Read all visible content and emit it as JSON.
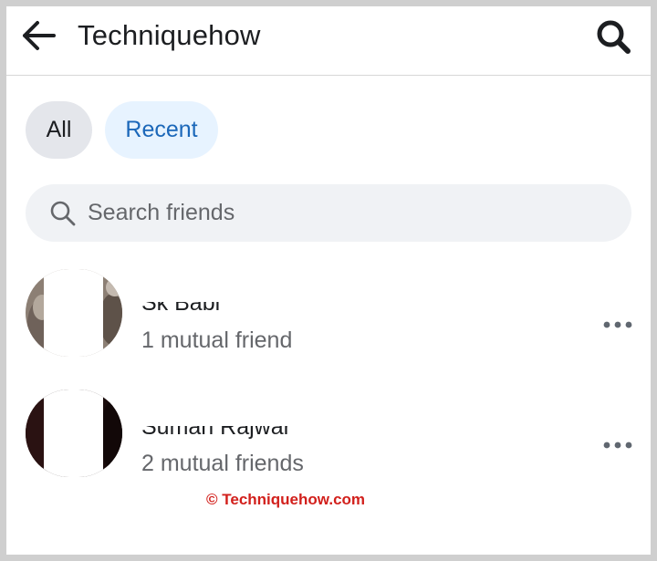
{
  "header": {
    "back_icon": "arrow-left-icon",
    "title": "Techniquehow",
    "search_icon": "search-icon"
  },
  "filters": [
    {
      "label": "All",
      "selected": false
    },
    {
      "label": "Recent",
      "selected": true
    }
  ],
  "search": {
    "icon": "search-icon",
    "placeholder": "Search friends",
    "value": ""
  },
  "friends": [
    {
      "name": "Sk Babi",
      "mutual": "1 mutual friend",
      "more_icon": "more-horizontal-icon"
    },
    {
      "name": "Suman Rajwar",
      "mutual": "2 mutual friends",
      "more_icon": "more-horizontal-icon"
    }
  ],
  "watermark": "© Techniquehow.com",
  "colors": {
    "accent": "#1b67b9",
    "accent_bg": "#e7f3ff",
    "chip_bg": "#e4e6eb",
    "search_bg": "#f0f2f5",
    "secondary_text": "#65676b",
    "watermark": "#d2201c"
  }
}
